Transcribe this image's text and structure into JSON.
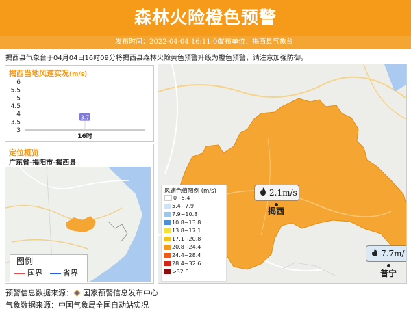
{
  "header": {
    "title": "森林火险橙色预警",
    "publish_time": "发布时间：2022-04-04 16:11:00",
    "publish_unit": "发布单位：揭西县气象台"
  },
  "description": "揭西县气象台于04月04日16时09分将揭西县森林火险黄色预警升级为橙色预警，请注意加强防御。",
  "wind_panel": {
    "title": "揭西当地风速实况",
    "unit": "(m/s)"
  },
  "chart_data": {
    "type": "bar",
    "categories": [
      "16时"
    ],
    "values": [
      3.7
    ],
    "ylim": [
      3,
      6
    ],
    "yticks": [
      "3",
      "3.5",
      "4",
      "4.5",
      "5",
      "5.5",
      "6"
    ],
    "data_labels": [
      "3.7"
    ],
    "grid": false
  },
  "location_panel": {
    "title": "定位概览",
    "path": "广东省-揭阳市-揭西县",
    "legend_title": "图例",
    "legend_items": [
      {
        "label": "国界",
        "color": "#d9534f"
      },
      {
        "label": "省界",
        "color": "#2b5fd9"
      }
    ]
  },
  "main_map": {
    "legend_title": "风速色值图例 (m/s)",
    "legend_rows": [
      {
        "label": "0~5.4",
        "color": "#ffffff"
      },
      {
        "label": "5.4~7.9",
        "color": "#cfe3f5"
      },
      {
        "label": "7.9~10.8",
        "color": "#9ec6ea"
      },
      {
        "label": "10.8~13.8",
        "color": "#4b8fd6"
      },
      {
        "label": "13.8~17.1",
        "color": "#f5e13a"
      },
      {
        "label": "17.1~20.8",
        "color": "#f5c21a"
      },
      {
        "label": "20.8~24.4",
        "color": "#f59a19"
      },
      {
        "label": "24.4~28.4",
        "color": "#ef5b16"
      },
      {
        "label": "28.4~32.6",
        "color": "#d62514"
      },
      {
        "label": ">32.6",
        "color": "#8e0c0c"
      }
    ],
    "stations": [
      {
        "name": "揭西",
        "speed": "2.1m/s"
      },
      {
        "name": "普宁",
        "speed": "7.7m/"
      }
    ],
    "fire_icon": "fire-icon",
    "region_color": "#f5a632"
  },
  "footer": {
    "source_warning": "预警信息数据来源：",
    "source_center": "国家预警信息发布中心",
    "source_weather": "气象数据来源：中国气象局全国自动站实况"
  }
}
